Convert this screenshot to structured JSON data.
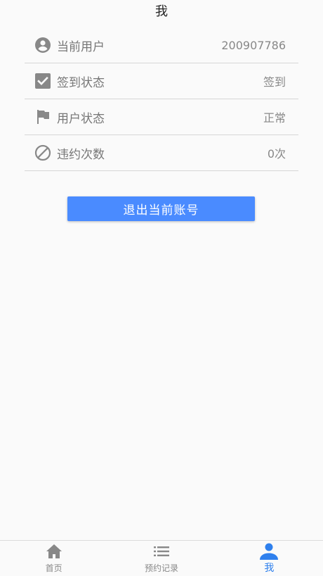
{
  "header": {
    "title": "我"
  },
  "info": {
    "rows": [
      {
        "label": "当前用户",
        "value": "200907786",
        "icon": "account-circle-icon"
      },
      {
        "label": "签到状态",
        "value": "签到",
        "icon": "checkbox-checked-icon"
      },
      {
        "label": "用户状态",
        "value": "正常",
        "icon": "flag-icon"
      },
      {
        "label": "违约次数",
        "value": "0次",
        "icon": "block-icon"
      }
    ]
  },
  "logout": {
    "label": "退出当前账号"
  },
  "tabbar": {
    "tabs": [
      {
        "label": "首页",
        "icon": "home-icon",
        "active": false
      },
      {
        "label": "预约记录",
        "icon": "list-icon",
        "active": false
      },
      {
        "label": "我",
        "icon": "person-icon",
        "active": true
      }
    ]
  },
  "colors": {
    "accent": "#4a8bff",
    "active_tab": "#2f80ed",
    "icon_gray": "#888888",
    "background": "#fafafa"
  }
}
